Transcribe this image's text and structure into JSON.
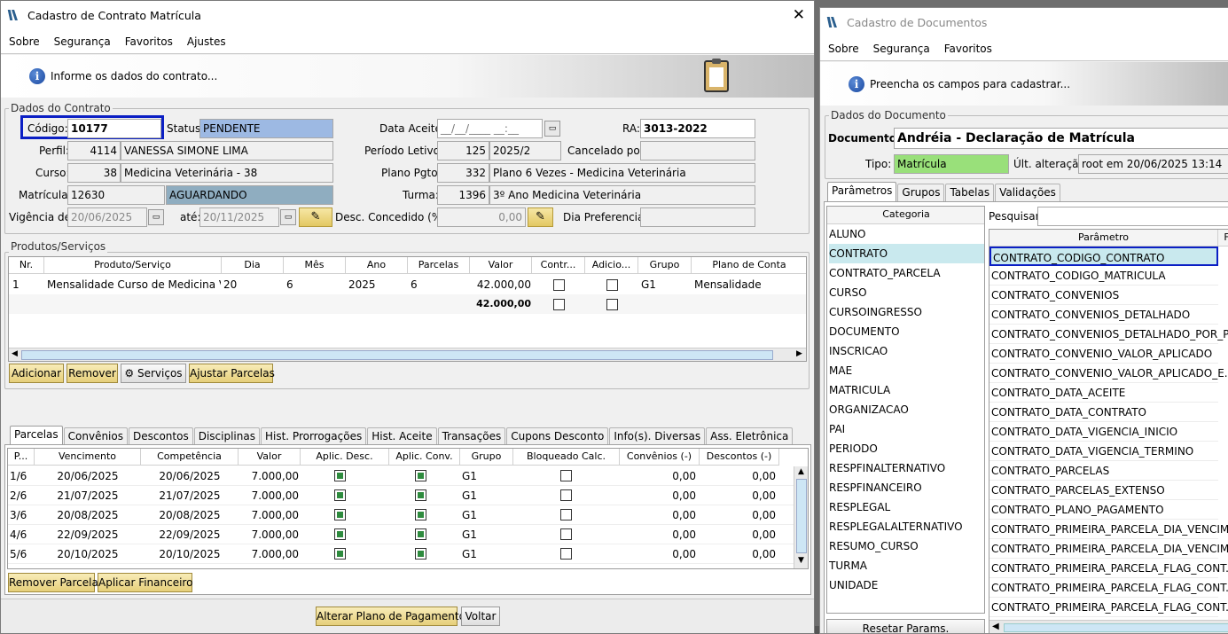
{
  "left_window": {
    "title": "Cadastro de Contrato Matrícula",
    "menu": [
      "Sobre",
      "Segurança",
      "Favoritos",
      "Ajustes"
    ],
    "info": "Informe os dados do contrato...",
    "group_contract": "Dados do Contrato",
    "labels": {
      "codigo": "Código:",
      "status": "Status:",
      "data_aceite": "Data Aceite:",
      "ra": "RA:",
      "perfil": "Perfil:",
      "periodo": "Período Letivo:",
      "cancelado": "Cancelado por:",
      "curso": "Curso:",
      "plano": "Plano Pgto:",
      "matricula": "Matrícula:",
      "turma": "Turma:",
      "vigencia": "Vigência de:",
      "ate": "até:",
      "desc": "Desc. Concedido (%):",
      "dia_pref": "Dia Preferencial:"
    },
    "values": {
      "codigo": "10177",
      "status": "PENDENTE",
      "data_aceite": "__/__/____ __:__",
      "ra": "3013-2022",
      "perfil_id": "4114",
      "perfil_nome": "VANESSA SIMONE LIMA",
      "periodo_id": "125",
      "periodo_nome": "2025/2",
      "curso_id": "38",
      "curso_nome": "Medicina Veterinária - 38",
      "plano_id": "332",
      "plano_nome": "Plano 6 Vezes - Medicina Veterinária",
      "matricula_id": "12630",
      "matricula_status": "AGUARDANDO",
      "turma_id": "1396",
      "turma_nome": "3º Ano Medicina Veterinária",
      "vig_de": "20/06/2025",
      "vig_ate": "20/11/2025",
      "desc": "0,00"
    },
    "products": {
      "title": "Produtos/Serviços",
      "headers": [
        "Nr.",
        "Produto/Serviço",
        "Dia",
        "Mês",
        "Ano",
        "Parcelas",
        "Valor",
        "Contr...",
        "Adicio...",
        "Grupo",
        "Plano de Conta"
      ],
      "row": {
        "nr": "1",
        "produto": "Mensalidade Curso de Medicina Ve...",
        "dia": "20",
        "mes": "6",
        "ano": "2025",
        "parcelas": "6",
        "valor": "42.000,00",
        "grupo": "G1",
        "plano": "Mensalidade"
      },
      "total": "42.000,00"
    },
    "buttons": {
      "adicionar": "Adicionar",
      "remover": "Remover",
      "servicos": "Serviços",
      "ajustar": "Ajustar Parcelas",
      "remover_parcela": "Remover Parcela",
      "aplicar": "Aplicar Financeiro",
      "alterar": "Alterar Plano de Pagamento",
      "voltar": "Voltar"
    },
    "tabs": [
      "Parcelas",
      "Convênios",
      "Descontos",
      "Disciplinas",
      "Hist. Prorrogações",
      "Hist. Aceite",
      "Transações",
      "Cupons Desconto",
      "Info(s). Diversas",
      "Ass. Eletrônica"
    ],
    "parcelas": {
      "headers": [
        "P...",
        "Vencimento",
        "Competência",
        "Valor",
        "Aplic. Desc.",
        "Aplic. Conv.",
        "Grupo",
        "Bloqueado Calc.",
        "Convênios (-)",
        "Descontos (-)"
      ],
      "rows": [
        {
          "p": "1/6",
          "venc": "20/06/2025",
          "comp": "20/06/2025",
          "valor": "7.000,00",
          "grupo": "G1",
          "conv": "0,00",
          "desc": "0,00"
        },
        {
          "p": "2/6",
          "venc": "21/07/2025",
          "comp": "21/07/2025",
          "valor": "7.000,00",
          "grupo": "G1",
          "conv": "0,00",
          "desc": "0,00"
        },
        {
          "p": "3/6",
          "venc": "20/08/2025",
          "comp": "20/08/2025",
          "valor": "7.000,00",
          "grupo": "G1",
          "conv": "0,00",
          "desc": "0,00"
        },
        {
          "p": "4/6",
          "venc": "22/09/2025",
          "comp": "22/09/2025",
          "valor": "7.000,00",
          "grupo": "G1",
          "conv": "0,00",
          "desc": "0,00"
        },
        {
          "p": "5/6",
          "venc": "20/10/2025",
          "comp": "20/10/2025",
          "valor": "7.000,00",
          "grupo": "G1",
          "conv": "0,00",
          "desc": "0,00"
        }
      ]
    }
  },
  "right_window": {
    "title": "Cadastro de Documentos",
    "menu": [
      "Sobre",
      "Segurança",
      "Favoritos"
    ],
    "info": "Preencha os campos para cadastrar...",
    "group": "Dados do Documento",
    "labels": {
      "documento": "Documento:",
      "tipo": "Tipo:",
      "ult": "Últ. alteração:",
      "pesquisar": "Pesquisar:"
    },
    "values": {
      "documento": "Andréia - Declaração de Matrícula",
      "tipo": "Matrícula",
      "ult": "root em 20/06/2025 13:14"
    },
    "tabs": [
      "Parâmetros",
      "Grupos",
      "Tabelas",
      "Validações"
    ],
    "categoria_header": "Categoria",
    "categorias": [
      "ALUNO",
      "CONTRATO",
      "CONTRATO_PARCELA",
      "CURSO",
      "CURSOINGRESSO",
      "DOCUMENTO",
      "INSCRICAO",
      "MAE",
      "MATRICULA",
      "ORGANIZACAO",
      "PAI",
      "PERIODO",
      "RESPFINALTERNATIVO",
      "RESPFINANCEIRO",
      "RESPLEGAL",
      "RESPLEGALALTERNATIVO",
      "RESUMO_CURSO",
      "TURMA",
      "UNIDADE"
    ],
    "parametro_header": "Parâmetro",
    "parametro_header2": "F",
    "parametros": [
      "CONTRATO_CODIGO_CONTRATO",
      "CONTRATO_CODIGO_MATRICULA",
      "CONTRATO_CONVENIOS",
      "CONTRATO_CONVENIOS_DETALHADO",
      "CONTRATO_CONVENIOS_DETALHADO_POR_P...",
      "CONTRATO_CONVENIO_VALOR_APLICADO",
      "CONTRATO_CONVENIO_VALOR_APLICADO_E...",
      "CONTRATO_DATA_ACEITE",
      "CONTRATO_DATA_CONTRATO",
      "CONTRATO_DATA_VIGENCIA_INICIO",
      "CONTRATO_DATA_VIGENCIA_TERMINO",
      "CONTRATO_PARCELAS",
      "CONTRATO_PARCELAS_EXTENSO",
      "CONTRATO_PLANO_PAGAMENTO",
      "CONTRATO_PRIMEIRA_PARCELA_DIA_VENCIM...",
      "CONTRATO_PRIMEIRA_PARCELA_DIA_VENCIM...",
      "CONTRATO_PRIMEIRA_PARCELA_FLAG_CONT...",
      "CONTRATO_PRIMEIRA_PARCELA_FLAG_CONT...",
      "CONTRATO_PRIMEIRA_PARCELA_FLAG_CONT..."
    ],
    "reset_button": "Resetar Params."
  },
  "colors": {
    "status": "#9db9e3",
    "aguardando": "#8fadc0",
    "tipo": "#99e07a",
    "selected": "#c9e9ee",
    "highlight": "#0b1fc4"
  }
}
